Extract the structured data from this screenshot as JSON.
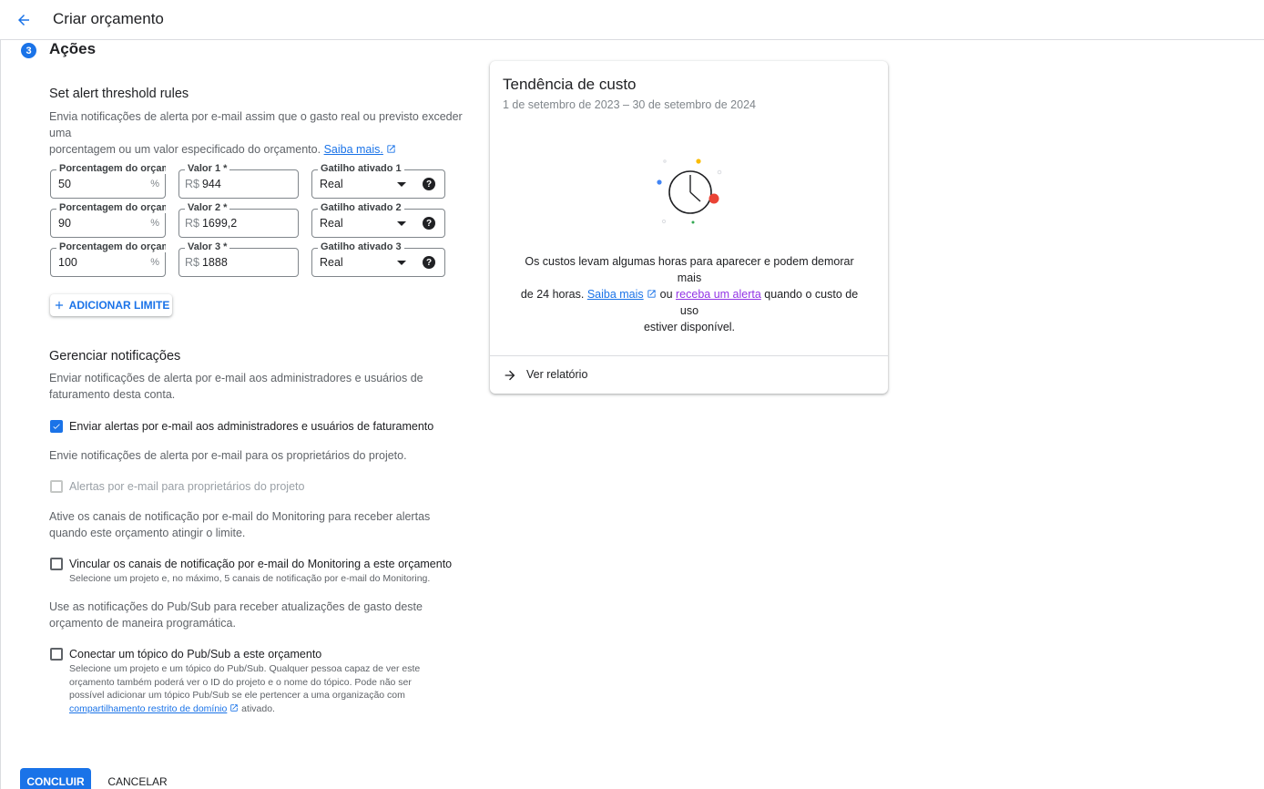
{
  "header": {
    "title": "Criar orçamento"
  },
  "step": {
    "number": "3",
    "title": "Ações"
  },
  "thresholds": {
    "heading": "Set alert threshold rules",
    "desc1": "Envia notificações de alerta por e-mail assim que o gasto real ou previsto exceder uma",
    "desc2": "porcentagem ou um valor especificado do orçamento.",
    "learn_more": "Saiba mais.",
    "rows": [
      {
        "pct_label": "Porcentagem do orçame",
        "pct": "50",
        "pct_suffix": "%",
        "val_label": "Valor 1 *",
        "currency": "R$",
        "val": "944",
        "trig_label": "Gatilho ativado 1",
        "trig": "Real"
      },
      {
        "pct_label": "Porcentagem do orçame",
        "pct": "90",
        "pct_suffix": "%",
        "val_label": "Valor 2 *",
        "currency": "R$",
        "val": "1699,2",
        "trig_label": "Gatilho ativado 2",
        "trig": "Real"
      },
      {
        "pct_label": "Porcentagem do orçame",
        "pct": "100",
        "pct_suffix": "%",
        "val_label": "Valor 3 *",
        "currency": "R$",
        "val": "1888",
        "trig_label": "Gatilho ativado 3",
        "trig": "Real"
      }
    ],
    "add_button": "ADICIONAR LIMITE"
  },
  "notifications": {
    "heading": "Gerenciar notificações",
    "desc1": "Enviar notificações de alerta por e-mail aos administradores e usuários de",
    "desc2": "faturamento desta conta.",
    "cb1_label": "Enviar alertas por e-mail aos administradores e usuários de faturamento",
    "cb1_checked": true,
    "owners_desc": "Envie notificações de alerta por e-mail para os proprietários do projeto.",
    "cb2_label": "Alertas por e-mail para proprietários do projeto",
    "cb2_checked": false,
    "monitoring_desc1": "Ative os canais de notificação por e-mail do Monitoring para receber alertas",
    "monitoring_desc2": "quando este orçamento atingir o limite.",
    "cb3_label": "Vincular os canais de notificação por e-mail do Monitoring a este orçamento",
    "cb3_sub": "Selecione um projeto e, no máximo, 5 canais de notificação por e-mail do Monitoring.",
    "cb3_checked": false,
    "pubsub_desc1": "Use as notificações do Pub/Sub para receber atualizações de gasto deste",
    "pubsub_desc2": "orçamento de maneira programática.",
    "cb4_label": "Conectar um tópico do Pub/Sub a este orçamento",
    "cb4_sub1": "Selecione um projeto e um tópico do Pub/Sub. Qualquer pessoa capaz de ver este",
    "cb4_sub2": "orçamento também poderá ver o ID do projeto e o nome do tópico. Pode não ser",
    "cb4_sub3": "possível adicionar um tópico Pub/Sub se ele pertencer a uma organização com",
    "cb4_link": "compartilhamento restrito de domínio",
    "cb4_after": " ativado.",
    "cb4_checked": false
  },
  "card": {
    "title": "Tendência de custo",
    "subtitle": "1 de setembro de 2023 – 30 de setembro de 2024",
    "msg1": "Os custos levam algumas horas para aparecer e podem demorar mais",
    "msg2": "de 24 horas.",
    "learn_more": "Saiba mais",
    "or": " ou ",
    "alert_link": "receba um alerta",
    "msg3": " quando o custo de uso",
    "msg4": "estiver disponível.",
    "report": "Ver relatório"
  },
  "footer": {
    "done": "CONCLUIR",
    "cancel": "CANCELAR"
  },
  "colors": {
    "accent": "#1a73e8",
    "visited_link": "#9334e6"
  }
}
